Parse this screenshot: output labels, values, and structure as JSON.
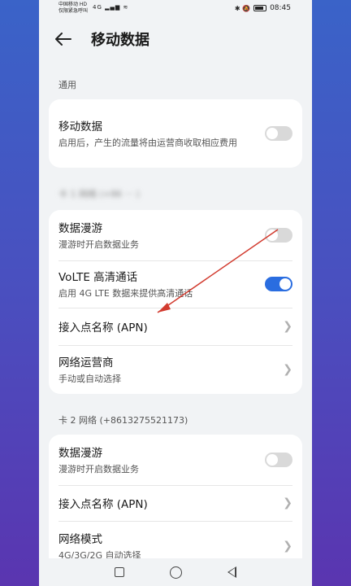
{
  "status_bar": {
    "carrier_line1": "中国移动 HD",
    "carrier_line2": "仅限紧急呼叫",
    "signal": "4G ▂▄▆ ≋",
    "icons_right": "✱ 🔕",
    "time": "08:45"
  },
  "header": {
    "title": "移动数据"
  },
  "general": {
    "section_label": "通用",
    "mobile_data": {
      "title": "移动数据",
      "subtitle": "启用后，产生的流量将由运营商收取相应费用",
      "toggle": false
    }
  },
  "sim1": {
    "section_label": "卡 1 网络 (+86 ··· )",
    "data_roaming": {
      "title": "数据漫游",
      "subtitle": "漫游时开启数据业务",
      "toggle": false
    },
    "volte": {
      "title": "VoLTE 高清通话",
      "subtitle": "启用 4G LTE 数据来提供高清通话",
      "toggle": true
    },
    "apn": {
      "title": "接入点名称 (APN)"
    },
    "carrier": {
      "title": "网络运营商",
      "subtitle": "手动或自动选择"
    }
  },
  "sim2": {
    "section_label": "卡 2 网络 (+8613275521173)",
    "data_roaming": {
      "title": "数据漫游",
      "subtitle": "漫游时开启数据业务",
      "toggle": false
    },
    "apn": {
      "title": "接入点名称 (APN)"
    },
    "network_mode": {
      "title": "网络模式",
      "subtitle": "4G/3G/2G 自动选择"
    }
  },
  "colors": {
    "accent": "#2a6de0",
    "annotation_arrow": "#d23b2f"
  }
}
